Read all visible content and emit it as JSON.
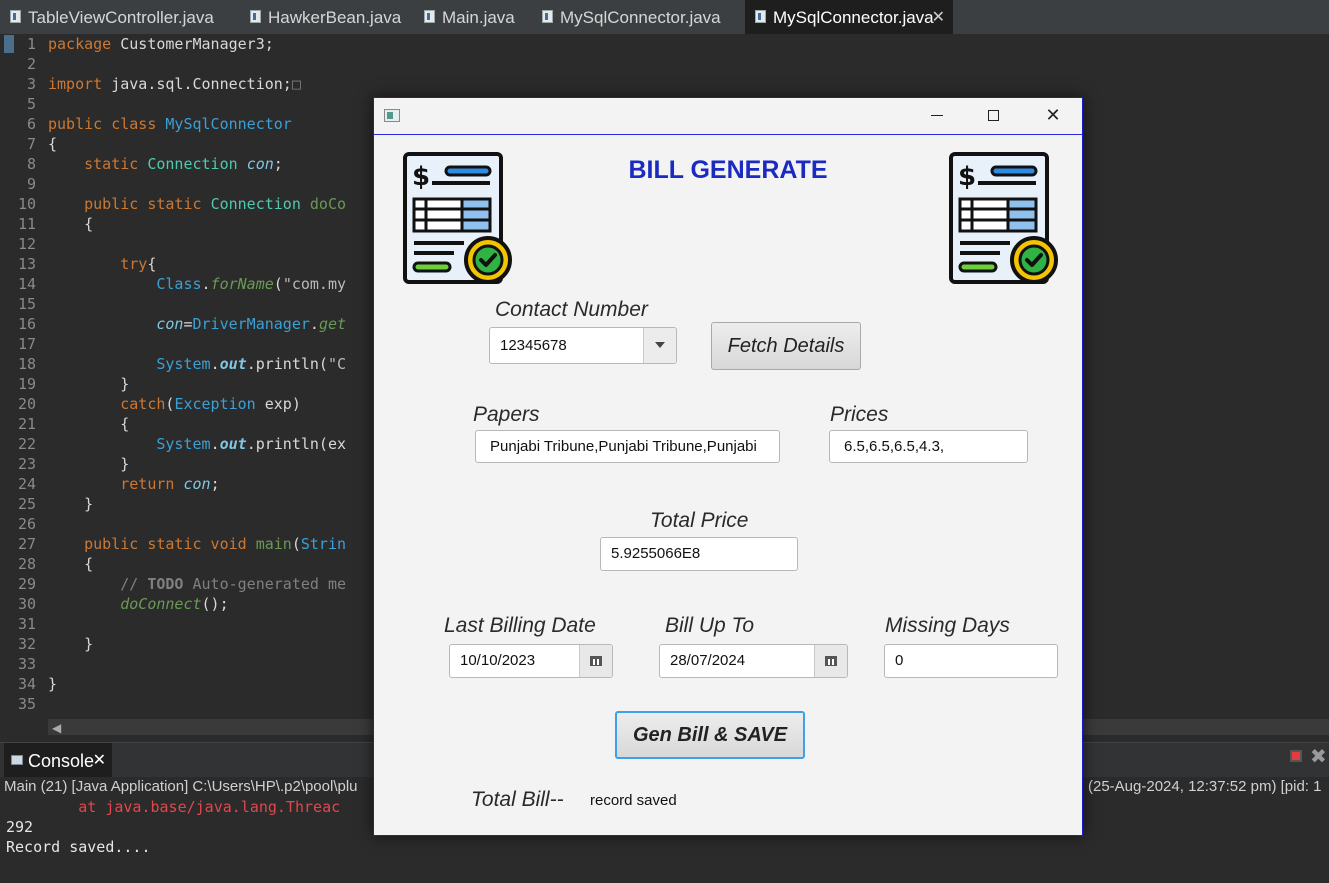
{
  "ide": {
    "tabs": [
      {
        "label": "TableViewController.java"
      },
      {
        "label": "HawkerBean.java"
      },
      {
        "label": "Main.java"
      },
      {
        "label": "MySqlConnector.java"
      },
      {
        "label": "MySqlConnector.java",
        "active": true
      }
    ],
    "tab_close": "✕",
    "lines": [
      {
        "n": "1",
        "c": [
          [
            "kw",
            "package"
          ],
          [
            "",
            " CustomerManager3;"
          ]
        ]
      },
      {
        "n": "2",
        "c": []
      },
      {
        "n": "3",
        "c": [
          [
            "kw",
            "import"
          ],
          [
            "",
            " java.sql.Connection;"
          ],
          [
            "cm",
            "□"
          ]
        ]
      },
      {
        "n": "5",
        "c": []
      },
      {
        "n": "6",
        "c": [
          [
            "kw",
            "public class "
          ],
          [
            "cls",
            "MySqlConnector"
          ]
        ]
      },
      {
        "n": "7",
        "c": [
          [
            "",
            "{"
          ]
        ]
      },
      {
        "n": "8",
        "c": [
          [
            "kw",
            "    static "
          ],
          [
            "ty",
            "Connection "
          ],
          [
            "it fn",
            "con"
          ],
          [
            "",
            ";"
          ]
        ]
      },
      {
        "n": "9",
        "c": []
      },
      {
        "n": "10",
        "c": [
          [
            "kw",
            "    public static "
          ],
          [
            "ty",
            "Connection "
          ],
          [
            "grn",
            "doCo"
          ]
        ]
      },
      {
        "n": "11",
        "c": [
          [
            "",
            "    {"
          ]
        ]
      },
      {
        "n": "12",
        "c": []
      },
      {
        "n": "13",
        "c": [
          [
            "kw",
            "        try"
          ],
          [
            "",
            "{"
          ]
        ]
      },
      {
        "n": "14",
        "c": [
          [
            "cls",
            "            Class"
          ],
          [
            "",
            "."
          ],
          [
            "it grn",
            "forName"
          ],
          [
            "",
            "("
          ],
          [
            "str",
            "\"com.my"
          ]
        ]
      },
      {
        "n": "15",
        "c": []
      },
      {
        "n": "16",
        "c": [
          [
            "it fn",
            "            con"
          ],
          [
            "",
            "="
          ],
          [
            "cls",
            "DriverManager"
          ],
          [
            "",
            "."
          ],
          [
            "it grn",
            "get"
          ]
        ]
      },
      {
        "n": "17",
        "c": []
      },
      {
        "n": "18",
        "c": [
          [
            "cls",
            "            System"
          ],
          [
            "",
            "."
          ],
          [
            "it bl fn",
            "out"
          ],
          [
            "",
            ".println("
          ],
          [
            "str",
            "\"C"
          ]
        ]
      },
      {
        "n": "19",
        "c": [
          [
            "",
            "        }"
          ]
        ]
      },
      {
        "n": "20",
        "c": [
          [
            "kw",
            "        catch"
          ],
          [
            "",
            "("
          ],
          [
            "cls",
            "Exception "
          ],
          [
            "",
            "exp)"
          ]
        ]
      },
      {
        "n": "21",
        "c": [
          [
            "",
            "        {"
          ]
        ]
      },
      {
        "n": "22",
        "c": [
          [
            "cls",
            "            System"
          ],
          [
            "",
            "."
          ],
          [
            "it bl fn",
            "out"
          ],
          [
            "",
            ".println(ex"
          ]
        ]
      },
      {
        "n": "23",
        "c": [
          [
            "",
            "        }"
          ]
        ]
      },
      {
        "n": "24",
        "c": [
          [
            "kw",
            "        return "
          ],
          [
            "it fn",
            "con"
          ],
          [
            "",
            ";"
          ]
        ]
      },
      {
        "n": "25",
        "c": [
          [
            "",
            "    }"
          ]
        ]
      },
      {
        "n": "26",
        "c": []
      },
      {
        "n": "27",
        "c": [
          [
            "kw",
            "    public static void "
          ],
          [
            "grn",
            "main"
          ],
          [
            "",
            "("
          ],
          [
            "cls",
            "Strin"
          ]
        ]
      },
      {
        "n": "28",
        "c": [
          [
            "",
            "    {"
          ]
        ]
      },
      {
        "n": "29",
        "c": [
          [
            "cm",
            "        // "
          ],
          [
            "cm bl",
            "TODO"
          ],
          [
            "cm",
            " Auto-generated me"
          ]
        ]
      },
      {
        "n": "30",
        "c": [
          [
            "it grn",
            "        doConnect"
          ],
          [
            "",
            "();"
          ]
        ]
      },
      {
        "n": "31",
        "c": []
      },
      {
        "n": "32",
        "c": [
          [
            "",
            "    }"
          ]
        ]
      },
      {
        "n": "33",
        "c": []
      },
      {
        "n": "34",
        "c": [
          [
            "",
            "}"
          ]
        ]
      },
      {
        "n": "35",
        "c": []
      }
    ],
    "console": {
      "tab_label": "Console",
      "status_left": "Main (21) [Java Application] C:\\Users\\HP\\.p2\\pool\\plu",
      "status_right": "(25-Aug-2024, 12:37:52 pm) [pid: 1",
      "lines": [
        {
          "text": "        at java.base/java.lang.Threac",
          "color": "#e0474c"
        },
        {
          "text": "292",
          "color": "#e6e6e6"
        },
        {
          "text": "Record saved....",
          "color": "#e6e6e6"
        }
      ]
    }
  },
  "app": {
    "heading": "BILL GENERATE",
    "contact": {
      "label": "Contact Number",
      "value": "12345678"
    },
    "fetch_button": "Fetch Details",
    "papers": {
      "label": "Papers",
      "value": "Punjabi Tribune,Punjabi Tribune,Punjabi"
    },
    "prices": {
      "label": "Prices",
      "value": "6.5,6.5,6.5,4.3,"
    },
    "total_price": {
      "label": "Total Price",
      "value": "5.9255066E8"
    },
    "last_billing": {
      "label": "Last Billing Date",
      "value": "10/10/2023"
    },
    "bill_up_to": {
      "label": "Bill Up To",
      "value": "28/07/2024"
    },
    "missing_days": {
      "label": "Missing Days",
      "value": "0"
    },
    "gen_button": "Gen Bill & SAVE",
    "total_bill": {
      "label": "Total Bill--",
      "status": "record saved"
    },
    "colors": {
      "heading": "#1b2bc1",
      "accent": "#3ea0e6",
      "window_border": "#1a1ad0"
    }
  }
}
